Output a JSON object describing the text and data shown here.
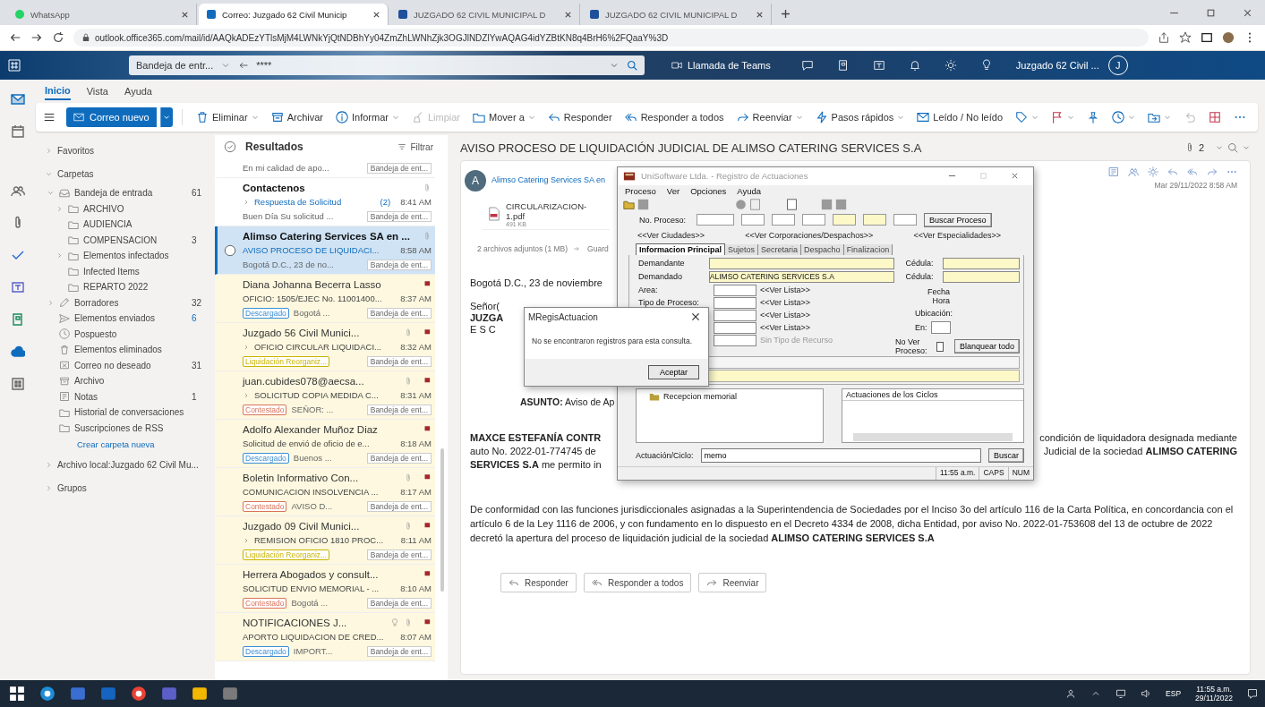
{
  "browser": {
    "tabs": [
      {
        "label": "WhatsApp",
        "selected": false,
        "kind": "whatsapp"
      },
      {
        "label": "Correo: Juzgado 62 Civil Municip",
        "selected": true,
        "kind": "outlook"
      },
      {
        "label": "JUZGADO 62 CIVIL MUNICIPAL D",
        "selected": false,
        "kind": "site"
      },
      {
        "label": "JUZGADO 62 CIVIL MUNICIPAL D",
        "selected": false,
        "kind": "site"
      }
    ],
    "url": "outlook.office365.com/mail/id/AAQkADEzYTlsMjM4LWNkYjQtNDBhYy04ZmZhLWNhZjk3OGJlNDZlYwAQAG4idYZBtKN8q4BrH6%2FQaaY%3D"
  },
  "header": {
    "folder_path": "Bandeja de entr...",
    "search_value": "****",
    "teams_label": "Llamada de Teams",
    "account": "Juzgado 62 Civil ...",
    "avatar": "J"
  },
  "rail": [
    {
      "kind": "mail",
      "selected": true
    },
    {
      "kind": "calendar",
      "selected": false
    },
    {
      "kind": "people",
      "selected": false
    },
    {
      "kind": "paperclip",
      "selected": false
    },
    {
      "kind": "check",
      "selected": false
    },
    {
      "kind": "tile",
      "selected": false
    },
    {
      "kind": "tile2",
      "selected": false
    },
    {
      "kind": "cloud",
      "selected": false
    },
    {
      "kind": "apps",
      "selected": false
    }
  ],
  "ribbon_tabs": [
    {
      "label": "Inicio",
      "selected": true
    },
    {
      "label": "Vista",
      "selected": false
    },
    {
      "label": "Ayuda",
      "selected": false
    }
  ],
  "toolbar": {
    "new_mail": "Correo nuevo",
    "items": [
      {
        "kind": "trash",
        "label": "Eliminar",
        "dropdown": true,
        "disabled": false
      },
      {
        "kind": "archive",
        "label": "Archivar",
        "dropdown": false,
        "disabled": false
      },
      {
        "kind": "info",
        "label": "Informar",
        "dropdown": true,
        "disabled": false
      },
      {
        "kind": "broom",
        "label": "Limpiar",
        "dropdown": false,
        "disabled": true
      },
      {
        "kind": "folder",
        "label": "Mover a",
        "dropdown": true,
        "disabled": false
      },
      {
        "kind": "reply",
        "label": "Responder",
        "dropdown": false,
        "disabled": false
      },
      {
        "kind": "reply-all",
        "label": "Responder a todos",
        "dropdown": false,
        "disabled": false
      },
      {
        "kind": "forward",
        "label": "Reenviar",
        "dropdown": true,
        "disabled": false
      },
      {
        "kind": "bolt",
        "label": "Pasos rápidos",
        "dropdown": true,
        "disabled": false
      },
      {
        "kind": "envelope",
        "label": "Leído / No leído",
        "dropdown": false,
        "disabled": false
      },
      {
        "kind": "tag",
        "dropdown": true,
        "disabled": false
      },
      {
        "kind": "flag",
        "dropdown": true,
        "disabled": false
      },
      {
        "kind": "pin",
        "dropdown": false,
        "disabled": false
      },
      {
        "kind": "clock",
        "dropdown": true,
        "disabled": false
      },
      {
        "kind": "move",
        "dropdown": true,
        "disabled": false
      },
      {
        "kind": "undo",
        "dropdown": false,
        "disabled": true
      },
      {
        "kind": "grid",
        "dropdown": false,
        "disabled": false
      },
      {
        "kind": "more",
        "dropdown": false,
        "disabled": false
      }
    ]
  },
  "folders": {
    "sections": [
      {
        "label": "Favoritos",
        "expanded": false
      },
      {
        "label": "Carpetas",
        "expanded": true,
        "children": [
          {
            "label": "Bandeja de entrada",
            "kind": "inbox",
            "count": "61",
            "expanded": true,
            "children": [
              {
                "label": "ARCHIVO",
                "expanded": false
              },
              {
                "label": "AUDIENCIA"
              },
              {
                "label": "COMPENSACION",
                "count": "3"
              },
              {
                "label": "Elementos infectados",
                "expanded": false
              },
              {
                "label": "Infected Items"
              },
              {
                "label": "REPARTO 2022"
              }
            ]
          },
          {
            "label": "Borradores",
            "kind": "drafts",
            "count": "32",
            "expanded": false
          },
          {
            "label": "Elementos enviados",
            "kind": "sent",
            "count": "6"
          },
          {
            "label": "Pospuesto",
            "kind": "clock"
          },
          {
            "label": "Elementos eliminados",
            "kind": "trash"
          },
          {
            "label": "Correo no deseado",
            "kind": "junk",
            "count": "31"
          },
          {
            "label": "Archivo",
            "kind": "archive"
          },
          {
            "label": "Notas",
            "kind": "note",
            "count": "1"
          },
          {
            "label": "Historial de conversaciones",
            "kind": "folder"
          },
          {
            "label": "Suscripciones de RSS",
            "kind": "folder"
          }
        ],
        "new_folder_link": "Crear carpeta nueva"
      },
      {
        "label": "Archivo local:Juzgado 62 Civil Mu...",
        "expanded": false
      },
      {
        "label": "Grupos",
        "expanded": false
      }
    ]
  },
  "message_list": {
    "title": "Resultados",
    "filter": "Filtrar",
    "messages": [
      {
        "preview": "En mi calidad de apo...",
        "folder": "Bandeja de ent...",
        "selected": false,
        "flagged": false
      },
      {
        "sender": "Contactenos",
        "subject": "Respuesta de Solicitud",
        "count": "(2)",
        "time": "8:41 AM",
        "preview": "Buen Día Su solicitud ...",
        "folder": "Bandeja de ent...",
        "thread": true,
        "attachment": true,
        "flagged": false,
        "selected": false,
        "unread": true
      },
      {
        "sender": "Alimso Catering Services SA en ...",
        "subject": "AVISO PROCESO DE LIQUIDACI...",
        "time": "8:58 AM",
        "preview": "Bogotá D.C., 23 de no...",
        "folder": "Bandeja de ent...",
        "thread": false,
        "attachment": true,
        "flagged": false,
        "selected": true,
        "unread": true
      },
      {
        "sender": "Diana Johanna Becerra Lasso",
        "subject": "OFICIO: 1505/EJEC No. 11001400...",
        "time": "8:37 AM",
        "tag": {
          "label": "Descargado",
          "color": "#3a8fd6"
        },
        "preview": "Bogotá ...",
        "folder": "Bandeja de ent...",
        "thread": false,
        "attachment": false,
        "flagged": true,
        "selected": false,
        "unread": false
      },
      {
        "sender": "Juzgado 56 Civil Munici...",
        "subject": "OFICIO CIRCULAR LIQUIDACI...",
        "time": "8:32 AM",
        "tag": {
          "label": "Liquidación Reorganiz...",
          "color": "#c9b400"
        },
        "folder": "Bandeja de ent...",
        "thread": true,
        "attachment": true,
        "flagged": true,
        "selected": false,
        "unread": false
      },
      {
        "sender": "juan.cubides078@aecsa...",
        "subject": "SOLICITUD COPIA MEDIDA C...",
        "time": "8:31 AM",
        "tag": {
          "label": "Contestado",
          "color": "#d9735b"
        },
        "preview": "SEÑOR: ...",
        "folder": "Bandeja de ent...",
        "thread": true,
        "attachment": true,
        "flagged": true,
        "selected": false,
        "unread": false
      },
      {
        "sender": "Adolfo Alexander Muñoz Diaz",
        "subject": "Solicitud de envió de oficio de e...",
        "time": "8:18 AM",
        "tag": {
          "label": "Descargado",
          "color": "#3a8fd6"
        },
        "preview": "Buenos ...",
        "folder": "Bandeja de ent...",
        "thread": false,
        "attachment": false,
        "flagged": true,
        "selected": false,
        "unread": false
      },
      {
        "sender": "Boletin Informativo Con...",
        "subject": "COMUNICACION INSOLVENCIA ...",
        "time": "8:17 AM",
        "tag": {
          "label": "Contestado",
          "color": "#d9735b"
        },
        "preview": "AVISO D...",
        "folder": "Bandeja de ent...",
        "thread": false,
        "attachment": true,
        "flagged": true,
        "selected": false,
        "unread": false
      },
      {
        "sender": "Juzgado 09 Civil Munici...",
        "subject": "REMISION OFICIO 1810 PROC...",
        "time": "8:11 AM",
        "tag": {
          "label": "Liquidación Reorganiz...",
          "color": "#c9b400"
        },
        "folder": "Bandeja de ent...",
        "thread": true,
        "attachment": true,
        "flagged": true,
        "selected": false,
        "unread": false
      },
      {
        "sender": "Herrera Abogados y consult...",
        "subject": "SOLICITUD ENVIO MEMORIAL - ...",
        "time": "8:10 AM",
        "tag": {
          "label": "Contestado",
          "color": "#d9735b"
        },
        "preview": "Bogotá ...",
        "folder": "Bandeja de ent...",
        "thread": false,
        "attachment": false,
        "flagged": true,
        "selected": false,
        "unread": false
      },
      {
        "sender": "NOTIFICACIONES J...",
        "subject": "APORTO LIQUIDACION DE CRED...",
        "time": "8:07 AM",
        "tag": {
          "label": "Descargado",
          "color": "#3a8fd6"
        },
        "preview": "IMPORT...",
        "folder": "Bandeja de ent...",
        "thread": false,
        "attachment": true,
        "reminder": true,
        "flagged": true,
        "selected": false,
        "unread": false
      }
    ]
  },
  "reading": {
    "subject": "AVISO PROCESO DE LIQUIDACIÓN JUDICIAL DE ALIMSO CATERING SERVICES S.A",
    "attachment_count": "2",
    "sender_initial": "A",
    "sender": "Alimso Catering Services SA en",
    "date": "Mar 29/11/2022 8:58 AM",
    "attachment": {
      "name": "CIRCULARIZACION-1.pdf",
      "size": "491 KB"
    },
    "attachments_summary": "2 archivos adjuntos (1 MB)",
    "save_link": "Guard",
    "paragraphs": [
      {
        "lines": [
          {
            "left": "Bogotá D.C., 23 de noviembre"
          }
        ]
      },
      {
        "lines": [
          {
            "left": "Señor("
          },
          {
            "left": "JUZGA",
            "bold": true
          },
          {
            "left": "E S C"
          }
        ]
      },
      {
        "indented": true,
        "lines": [
          {
            "left": "**ASUNTO:** Aviso de Ap"
          }
        ]
      },
      {
        "lines": [
          {
            "left": "**MAXCE ESTEFANÍA CONTR**",
            "right": "condición de liquidadora designada mediante"
          },
          {
            "left": "auto No. 2022-01-774745 de",
            "right": "Judicial de la sociedad **ALIMSO CATERING**"
          },
          {
            "left": "**SERVICES S.A** me permito in"
          }
        ]
      },
      {
        "lines": [
          {
            "left": "De conformidad con las funciones jurisdiccionales asignadas a la Superintendencia de Sociedades por el Inciso 3o del artículo 116 de la Carta Política, en concordancia con el artículo 6 de la Ley 1116 de 2006, y con fundamento en lo dispuesto en el Decreto 4334 de 2008, dicha Entidad, por aviso No. 2022-01-753608 del 13 de octubre de 2022 decretó la apertura del proceso de liquidación judicial de la sociedad **ALIMSO CATERING SERVICES S.A**"
          }
        ]
      }
    ],
    "actions": [
      {
        "kind": "reply",
        "label": "Responder"
      },
      {
        "kind": "reply-all",
        "label": "Responder a todos"
      },
      {
        "kind": "forward",
        "label": "Reenviar"
      }
    ]
  },
  "unisoft": {
    "title": "UniSoftware Ltda. - Registro de Actuaciones",
    "menu": [
      "Proceso",
      "Ver",
      "Opciones",
      "Ayuda"
    ],
    "process_label": "No. Proceso:",
    "process_fields": [
      {
        "highlighted": false
      },
      {
        "highlighted": false
      },
      {
        "highlighted": false
      },
      {
        "highlighted": false
      },
      {
        "highlighted": true
      },
      {
        "highlighted": true
      },
      {
        "highlighted": false
      }
    ],
    "search_button": "Buscar Proceso",
    "links": [
      "<<Ver Ciudades>>",
      "<<Ver Corporaciones/Despachos>>",
      "<<Ver Especialidades>>"
    ],
    "tabs": [
      {
        "label": "Informacion Principal",
        "selected": true
      },
      {
        "label": "Sujetos",
        "selected": false
      },
      {
        "label": "Secretaria",
        "selected": false
      },
      {
        "label": "Despacho",
        "selected": false
      },
      {
        "label": "Finalizacion",
        "selected": false
      }
    ],
    "parties": [
      {
        "label": "Demandante",
        "id_label": "Cédula:"
      },
      {
        "label": "Demandado",
        "value": "ALIMSO CATERING SERVICES S.A",
        "id_label": "Cédula:"
      }
    ],
    "lists": [
      {
        "label": "Area:",
        "link": "<<Ver Lista>>"
      },
      {
        "label": "Tipo de Proceso:",
        "link": "<<Ver Lista>>"
      },
      {
        "link": "<<Ver Lista>>"
      },
      {
        "link": "<<Ver Lista>>"
      },
      {
        "link": "Sin Tipo de Recurso",
        "disabled": true
      }
    ],
    "fecha_label": "Fecha",
    "hora_label": "Hora",
    "ubicacion_label": "Ubicación:",
    "en_label": "En:",
    "no_ver_label": "No Ver Proceso:",
    "no_ver_checked": false,
    "clear_button": "Blanquear todo",
    "tree_item": "Recepcion memorial",
    "list_header": "Actuaciones de los Ciclos",
    "cycle_label": "Actuación/Ciclo:",
    "cycle_value": "memo",
    "find_button": "Buscar",
    "status": [
      "11:55 a.m.",
      "CAPS",
      "NUM"
    ]
  },
  "dialog": {
    "title": "MRegisActuacion",
    "message": "No se encontraron registros para esta consulta.",
    "button": "Aceptar"
  },
  "taskbar": {
    "apps": [
      {
        "kind": "start"
      },
      {
        "kind": "edge"
      },
      {
        "kind": "store"
      },
      {
        "kind": "mail"
      },
      {
        "kind": "chrome"
      },
      {
        "kind": "teams"
      },
      {
        "kind": "explorer"
      },
      {
        "kind": "app"
      }
    ],
    "language": "ESP",
    "time": "11:55 a.m.",
    "date": "29/11/2022"
  }
}
